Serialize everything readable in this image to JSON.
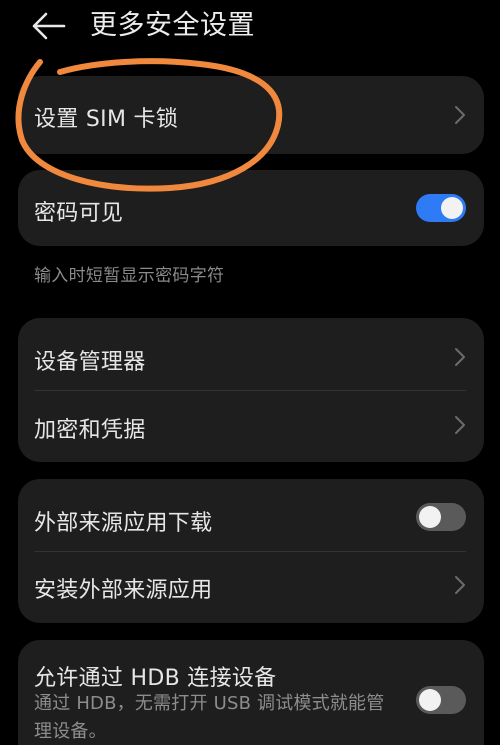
{
  "header": {
    "title": "更多安全设置",
    "back_icon": "back-arrow-icon"
  },
  "sim_lock": {
    "label": "设置 SIM 卡锁"
  },
  "password_visible": {
    "label": "密码可见",
    "enabled": true,
    "hint": "输入时短暂显示密码字符"
  },
  "device_group": {
    "items": [
      {
        "label": "设备管理器"
      },
      {
        "label": "加密和凭据"
      }
    ]
  },
  "external_sources": {
    "download": {
      "label": "外部来源应用下载",
      "enabled": false
    },
    "install": {
      "label": "安装外部来源应用"
    }
  },
  "hdb": {
    "label": "允许通过 HDB 连接设备",
    "description": "通过 HDB，无需打开 USB 调试模式就能管理设备。",
    "enabled": false
  },
  "colors": {
    "background": "#000000",
    "card": "#1e1e1e",
    "toggle_on": "#2f7bf5",
    "toggle_off": "#5a5a5a",
    "annotation": "#f0883e"
  }
}
